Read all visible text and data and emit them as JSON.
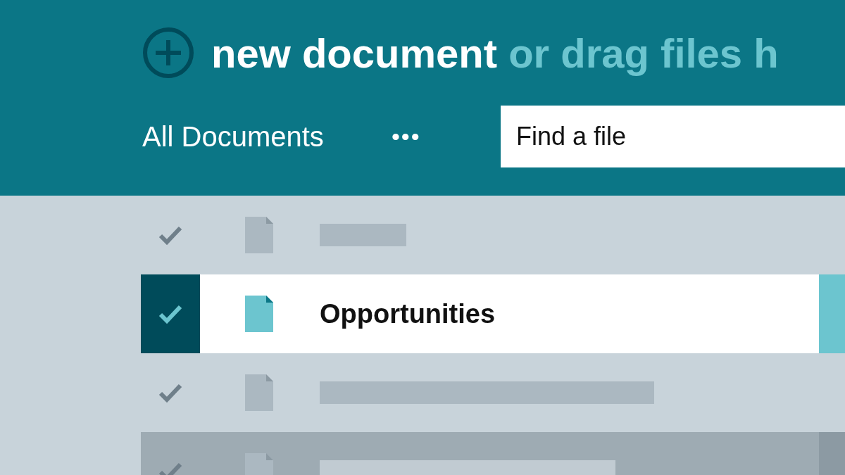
{
  "header": {
    "new_label": "new document",
    "drag_hint": "or drag files h"
  },
  "toolbar": {
    "view": "All Documents",
    "more": "•••",
    "search": {
      "placeholder": "Find a file"
    }
  },
  "rows": [
    {
      "name": null,
      "selected": false,
      "hovered": false
    },
    {
      "name": "Opportunities",
      "selected": true,
      "hovered": false
    },
    {
      "name": null,
      "selected": false,
      "hovered": false
    },
    {
      "name": null,
      "selected": false,
      "hovered": true
    }
  ]
}
